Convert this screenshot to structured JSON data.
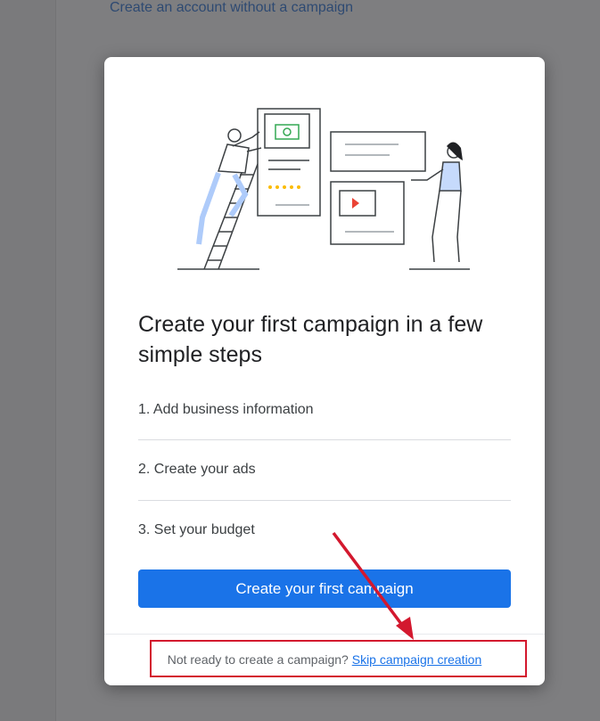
{
  "background": {
    "link_text": "Create an account without a campaign"
  },
  "modal": {
    "title": "Create your first campaign in a few simple steps",
    "steps": [
      "1. Add business information",
      "2. Create your ads",
      "3. Set your budget"
    ],
    "cta_label": "Create your first campaign",
    "footer_text": "Not ready to create a campaign?",
    "footer_link": "Skip campaign creation"
  },
  "colors": {
    "primary": "#1a73e8",
    "annotation": "#d3182e",
    "overlay": "#7e7e80"
  }
}
